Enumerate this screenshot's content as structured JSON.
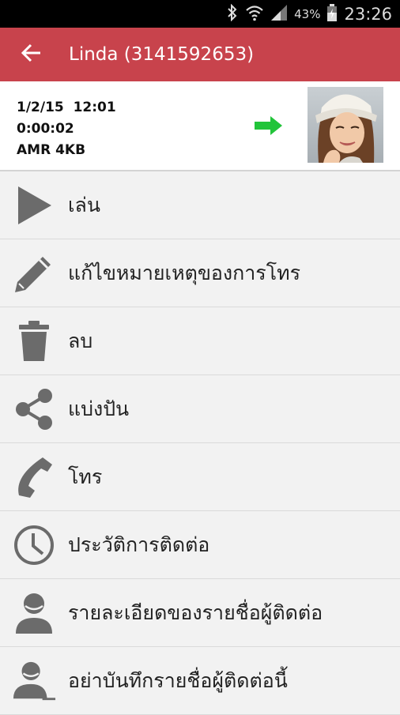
{
  "status_bar": {
    "battery_percent": "43%",
    "time": "23:26",
    "icons": [
      "bluetooth-icon",
      "wifi-icon",
      "signal-icon",
      "battery-icon"
    ]
  },
  "app_bar": {
    "title": "Linda (3141592653)",
    "color": "#c8434c",
    "back_icon": "back-arrow-icon"
  },
  "recording": {
    "date_time": "1/2/15  12:01",
    "duration": "0:00:02",
    "format": "AMR 4KB",
    "direction_icon": "outgoing-arrow-icon",
    "direction_color": "#22c43a"
  },
  "menu": [
    {
      "label": "เล่น",
      "icon": "play-icon"
    },
    {
      "label": "แก้ไขหมายเหตุของการโทร",
      "icon": "pencil-icon"
    },
    {
      "label": "ลบ",
      "icon": "trash-icon"
    },
    {
      "label": "แบ่งปัน",
      "icon": "share-icon"
    },
    {
      "label": "โทร",
      "icon": "phone-icon"
    },
    {
      "label": "ประวัติการติดต่อ",
      "icon": "clock-icon"
    },
    {
      "label": "รายละเอียดของรายชื่อผู้ติดต่อ",
      "icon": "contact-icon"
    },
    {
      "label": "อย่าบันทึกรายชื่อผู้ติดต่อนี้",
      "icon": "contact-exclude-icon"
    }
  ]
}
